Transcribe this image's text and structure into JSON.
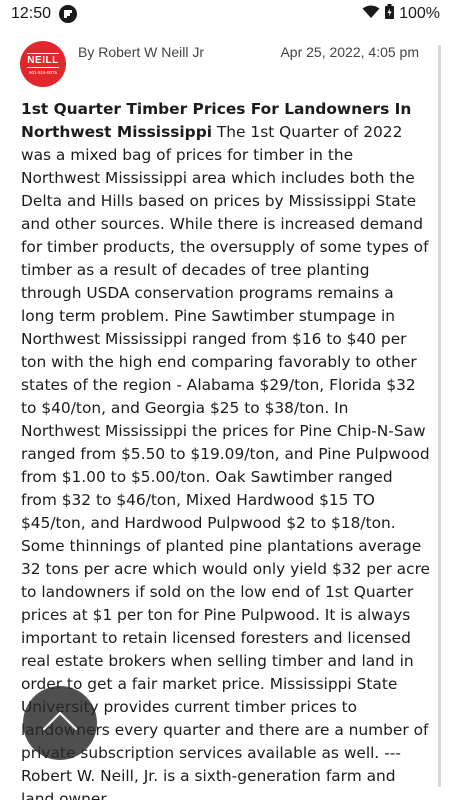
{
  "status_bar": {
    "time": "12:50",
    "battery_percent": "100%",
    "icons": [
      "flipboard-icon",
      "wifi-icon",
      "battery-icon"
    ]
  },
  "post": {
    "avatar": {
      "logo_text": "NEILL",
      "phone": "601-516-0075",
      "color": "#e2262b"
    },
    "author": "By Robert W Neill Jr",
    "date": "Apr 25, 2022, 4:05 pm",
    "title": "1st Quarter Timber Prices For Landowners In Northwest Mississippi",
    "body": " The 1st Quarter of 2022 was a mixed bag of prices for timber in the Northwest Mississippi area which includes both the Delta and Hills based on prices by Mississippi State and other sources. While there is increased demand for timber products, the oversupply of some types of timber as a result of decades of tree planting through USDA conservation programs remains a long term problem. Pine Sawtimber stumpage in Northwest Mississippi ranged from $16 to $40 per ton with the high end comparing favorably to other states of the region - Alabama $29/ton, Florida $32 to $40/ton, and Georgia $25 to $38/ton. In Northwest Mississippi the prices for Pine Chip-N-Saw ranged from $5.50 to $19.09/ton, and Pine Pulpwood from $1.00 to $5.00/ton. Oak Sawtimber ranged from $32 to $46/ton, Mixed Hardwood $15 TO $45/ton, and Hardwood Pulpwood $2 to $18/ton. Some thinnings of planted pine plantations average 32 tons per acre which would only yield $32 per acre to landowners if sold on the low end of 1st Quarter prices at $1 per ton for Pine Pulpwood. It is always important to retain licensed foresters and licensed real estate brokers when selling timber and land in order to get a fair market price. Mississippi State University provides current timber prices to landowners every quarter and there are a number of private subscription services available as well. --- Robert W. Neill, Jr. is a sixth-generation farm and land owner"
  },
  "fab": {
    "icon": "chevron-up-icon"
  }
}
